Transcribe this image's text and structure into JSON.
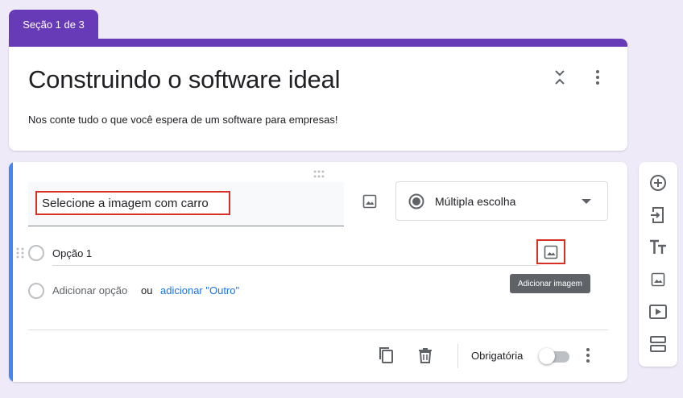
{
  "section_tab": {
    "label": "Seção 1 de 3"
  },
  "header": {
    "title": "Construindo o software ideal",
    "description": "Nos conte tudo o que você espera de um software para empresas!"
  },
  "question": {
    "title": "Selecione a imagem com carro",
    "type_label": "Múltipla escolha",
    "options": [
      {
        "label": "Opção 1"
      }
    ],
    "add_option_label": "Adicionar opção",
    "or_label": "ou",
    "add_other_label": "adicionar \"Outro\"",
    "tooltip": "Adicionar imagem",
    "required_label": "Obrigatória",
    "required": false
  },
  "colors": {
    "accent": "#673ab7",
    "active": "#4285f4",
    "highlight": "#d93025",
    "link": "#1a73e8",
    "background": "#efeaf8"
  },
  "icons": {
    "header": [
      "collapse-icon",
      "more-vert-icon"
    ],
    "question": [
      "drag-handle-icon",
      "image-icon",
      "radio-checked-icon",
      "dropdown-arrow-icon"
    ],
    "footer": [
      "copy-icon",
      "trash-icon",
      "more-vert-icon"
    ],
    "side_toolbar": [
      "add-circle-icon",
      "import-icon",
      "title-icon",
      "image-icon",
      "video-icon",
      "section-icon"
    ]
  }
}
